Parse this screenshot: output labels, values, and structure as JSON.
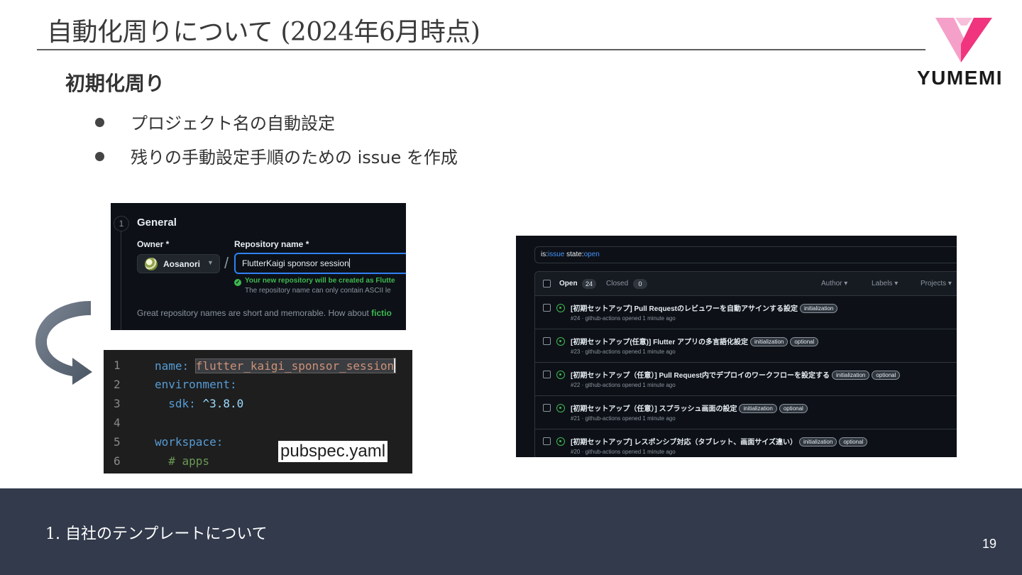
{
  "slide": {
    "title": "自動化周りについて (2024年6月時点)",
    "heading": "初期化周り",
    "bullets": [
      "プロジェクト名の自動設定",
      "残りの手動設定手順のための  issue を作成"
    ],
    "logo_text": "YUMEMI",
    "colors": {
      "footer": "#323a4b",
      "logo_pink": "#f0347d",
      "logo_light_pink": "#f5a0c8"
    }
  },
  "repo_form": {
    "step": "1",
    "section": "General",
    "owner_label": "Owner *",
    "owner_name": "Aosanori",
    "repo_label": "Repository name *",
    "repo_value": "FlutterKaigi sponsor session",
    "valid_message": "Your new repository will be created as Flutte",
    "ascii_message": "The repository name can only contain ASCII le",
    "hint_prefix": "Great repository names are short and memorable. How about ",
    "hint_suggestion": "fictio"
  },
  "code": {
    "lines": [
      {
        "num": "1",
        "key": "name",
        "value": "flutter_kaigi_sponsor_session"
      },
      {
        "num": "2",
        "key": "environment",
        "value": ""
      },
      {
        "num": "3",
        "key": "sdk",
        "value": "^3.8.0"
      },
      {
        "num": "4",
        "key": "",
        "value": ""
      },
      {
        "num": "5",
        "key": "workspace",
        "value": ""
      },
      {
        "num": "6",
        "key": "",
        "value": "# apps"
      }
    ],
    "file_label": "pubspec.yaml"
  },
  "issues": {
    "filter_is": "is:",
    "filter_is_value": "issue",
    "filter_state": " state:",
    "filter_state_value": "open",
    "open_label": "Open",
    "open_count": "24",
    "closed_label": "Closed",
    "closed_count": "0",
    "filters": [
      "Author ▾",
      "Labels ▾",
      "Projects ▾"
    ],
    "rows": [
      {
        "title": "[初期セットアップ] Pull Requestのレビュワーを自動アサインする設定",
        "labels": [
          "initialization"
        ],
        "meta": "#24 · github-actions opened 1 minute ago"
      },
      {
        "title": "[初期セットアップ(任意)] Flutter アプリの多言語化設定",
        "labels": [
          "initialization",
          "optional"
        ],
        "meta": "#23 · github-actions opened 1 minute ago"
      },
      {
        "title": "[初期セットアップ（任意）] Pull Request内でデプロイのワークフローを設定する",
        "labels": [
          "initialization",
          "optional"
        ],
        "meta": "#22 · github-actions opened 1 minute ago"
      },
      {
        "title": "[初期セットアップ（任意）] スプラッシュ画面の設定",
        "labels": [
          "initialization",
          "optional"
        ],
        "meta": "#21 · github-actions opened 1 minute ago"
      },
      {
        "title": "[初期セットアップ] レスポンシブ対応（タブレット、画面サイズ違い）",
        "labels": [
          "initialization",
          "optional"
        ],
        "meta": "#20 · github-actions opened 1 minute ago"
      }
    ]
  },
  "footer": {
    "section": "1.  自社のテンプレートについて",
    "page": "19"
  }
}
